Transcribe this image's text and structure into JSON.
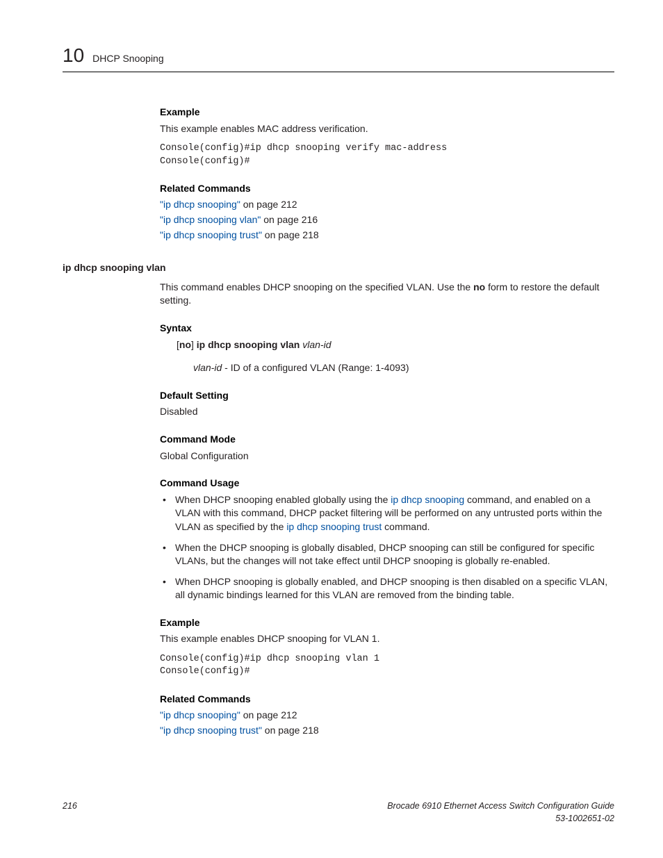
{
  "header": {
    "chapter_number": "10",
    "chapter_title": "DHCP Snooping"
  },
  "section1": {
    "heading_example": "Example",
    "example_intro": "This example enables MAC address verification.",
    "console": "Console(config)#ip dhcp snooping verify mac-address\nConsole(config)#",
    "heading_related": "Related Commands",
    "related": [
      {
        "link": "\"ip dhcp snooping\"",
        "rest": " on page 212"
      },
      {
        "link": "\"ip dhcp snooping vlan\"",
        "rest": " on page 216"
      },
      {
        "link": "\"ip dhcp snooping trust\"",
        "rest": " on page 218"
      }
    ]
  },
  "command": {
    "name": "ip dhcp snooping vlan",
    "desc_pre": "This command enables DHCP snooping on the specified VLAN. Use the ",
    "desc_bold": "no",
    "desc_post": " form to restore the default setting.",
    "syntax_heading": "Syntax",
    "syntax_prefix_open": "[",
    "syntax_no": "no",
    "syntax_prefix_close": "] ",
    "syntax_cmd": "ip dhcp snooping vlan",
    "syntax_param": " vlan-id",
    "param_name": "vlan-id",
    "param_desc": " - ID of a configured VLAN (Range: 1-4093)",
    "default_heading": "Default Setting",
    "default_value": "Disabled",
    "mode_heading": "Command Mode",
    "mode_value": "Global Configuration",
    "usage_heading": "Command Usage",
    "usage": [
      {
        "pre": "When DHCP snooping enabled globally using the ",
        "link1": "ip dhcp snooping",
        "mid": " command, and enabled on a VLAN with this command, DHCP packet filtering will be performed on any untrusted ports within the VLAN as specified by the ",
        "link2": "ip dhcp snooping trust",
        "post": " command."
      },
      {
        "text": "When the DHCP snooping is globally disabled, DHCP snooping can still be configured for specific VLANs, but the changes will not take effect until DHCP snooping is globally re-enabled."
      },
      {
        "text": "When DHCP snooping is globally enabled, and DHCP snooping is then disabled on a specific VLAN, all dynamic bindings learned for this VLAN are removed from the binding table."
      }
    ],
    "example_heading": "Example",
    "example_intro": "This example enables DHCP snooping for VLAN 1.",
    "example_console": "Console(config)#ip dhcp snooping vlan 1\nConsole(config)#",
    "related_heading": "Related Commands",
    "related": [
      {
        "link": "\"ip dhcp snooping\"",
        "rest": " on page 212"
      },
      {
        "link": "\"ip dhcp snooping trust\"",
        "rest": " on page 218"
      }
    ]
  },
  "footer": {
    "page_number": "216",
    "book_title": "Brocade 6910 Ethernet Access Switch Configuration Guide",
    "doc_number": "53-1002651-02"
  }
}
